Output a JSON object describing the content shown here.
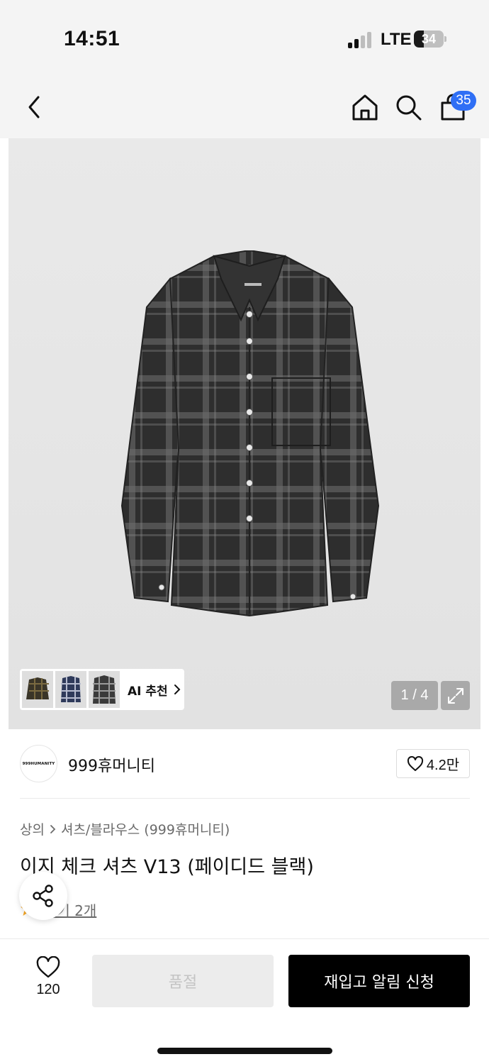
{
  "status_bar": {
    "time": "14:51",
    "network": "LTE",
    "battery": "34",
    "battery_level": 0.34
  },
  "nav": {
    "icons": [
      "back-chevron-icon",
      "home-icon",
      "search-icon",
      "shopping-bag-icon"
    ],
    "cart_count": "35"
  },
  "gallery": {
    "ai_recommend_label": "AI 추천",
    "page_counter": "1 / 4",
    "current_page": 1,
    "total_pages": 4
  },
  "brand": {
    "logo_text": "999HUMANITY",
    "name": "999휴머니티",
    "like_count": "4.2만"
  },
  "breadcrumb": [
    "상의",
    "셔츠/블라우스 (999휴머니티)"
  ],
  "product": {
    "title": "이지 체크 셔츠 V13 (페이디드 블랙)",
    "reviews_label": "후기 2개"
  },
  "bottom_bar": {
    "wish_count": "120",
    "sold_out_label": "품절",
    "restock_label": "재입고 알림 신청"
  },
  "colors": {
    "accent_badge": "#2f6ff5",
    "primary_button": "#000000",
    "disabled_button": "#ececec",
    "star": "#f5a623"
  }
}
